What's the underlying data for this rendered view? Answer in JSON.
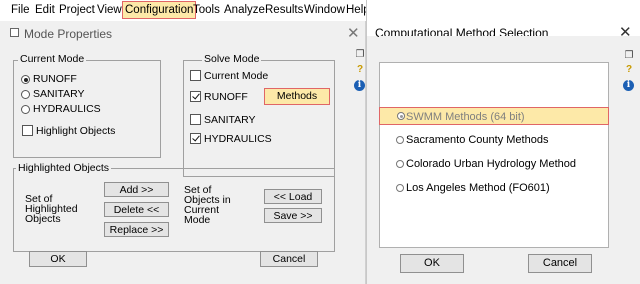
{
  "menubar": {
    "items": [
      "File",
      "Edit",
      "Project",
      "View",
      "Configuration",
      "Tools",
      "Analyze",
      "Results",
      "Window",
      "Help"
    ]
  },
  "left_dialog": {
    "title": "Mode Properties",
    "current_mode": {
      "label": "Current Mode",
      "options": [
        "RUNOFF",
        "SANITARY",
        "HYDRAULICS"
      ],
      "selected": "RUNOFF",
      "highlight_objects_label": "Highlight Objects",
      "highlight_objects_checked": false
    },
    "solve_mode": {
      "label": "Solve Mode",
      "items": [
        {
          "label": "Current Mode",
          "checked": false
        },
        {
          "label": "RUNOFF",
          "checked": true
        },
        {
          "label": "SANITARY",
          "checked": false
        },
        {
          "label": "HYDRAULICS",
          "checked": true
        }
      ],
      "methods_button": "Methods"
    },
    "highlighted_objects": {
      "label": "Highlighted Objects",
      "set_label": "Set of\nHighlighted\nObjects",
      "buttons": [
        "Add >>",
        "Delete <<",
        "Replace >>"
      ],
      "current_label": "Set of\nObjects in\nCurrent\nMode",
      "load_button": "<< Load",
      "save_button": "Save >>"
    },
    "ok_button": "OK",
    "cancel_button": "Cancel",
    "close": "✕"
  },
  "right_dialog": {
    "title": "Computational Method Selection",
    "close": "✕",
    "options": [
      {
        "label": "SWMM Methods (64 bit)",
        "selected": true
      },
      {
        "label": "Sacramento County Methods",
        "selected": false
      },
      {
        "label": "Colorado Urban Hydrology Method",
        "selected": false
      },
      {
        "label": "Los Angeles Method (FO601)",
        "selected": false
      }
    ],
    "ok_button": "OK",
    "cancel_button": "Cancel"
  },
  "side_tools": {
    "icons": [
      "copy-icon",
      "help-icon",
      "info-icon"
    ],
    "help_glyph": "?",
    "info_glyph": "i"
  },
  "colors": {
    "highlight_fill": "#fde9a8",
    "highlight_border": "#e06666",
    "dialog_bg": "#f0f0f0"
  }
}
